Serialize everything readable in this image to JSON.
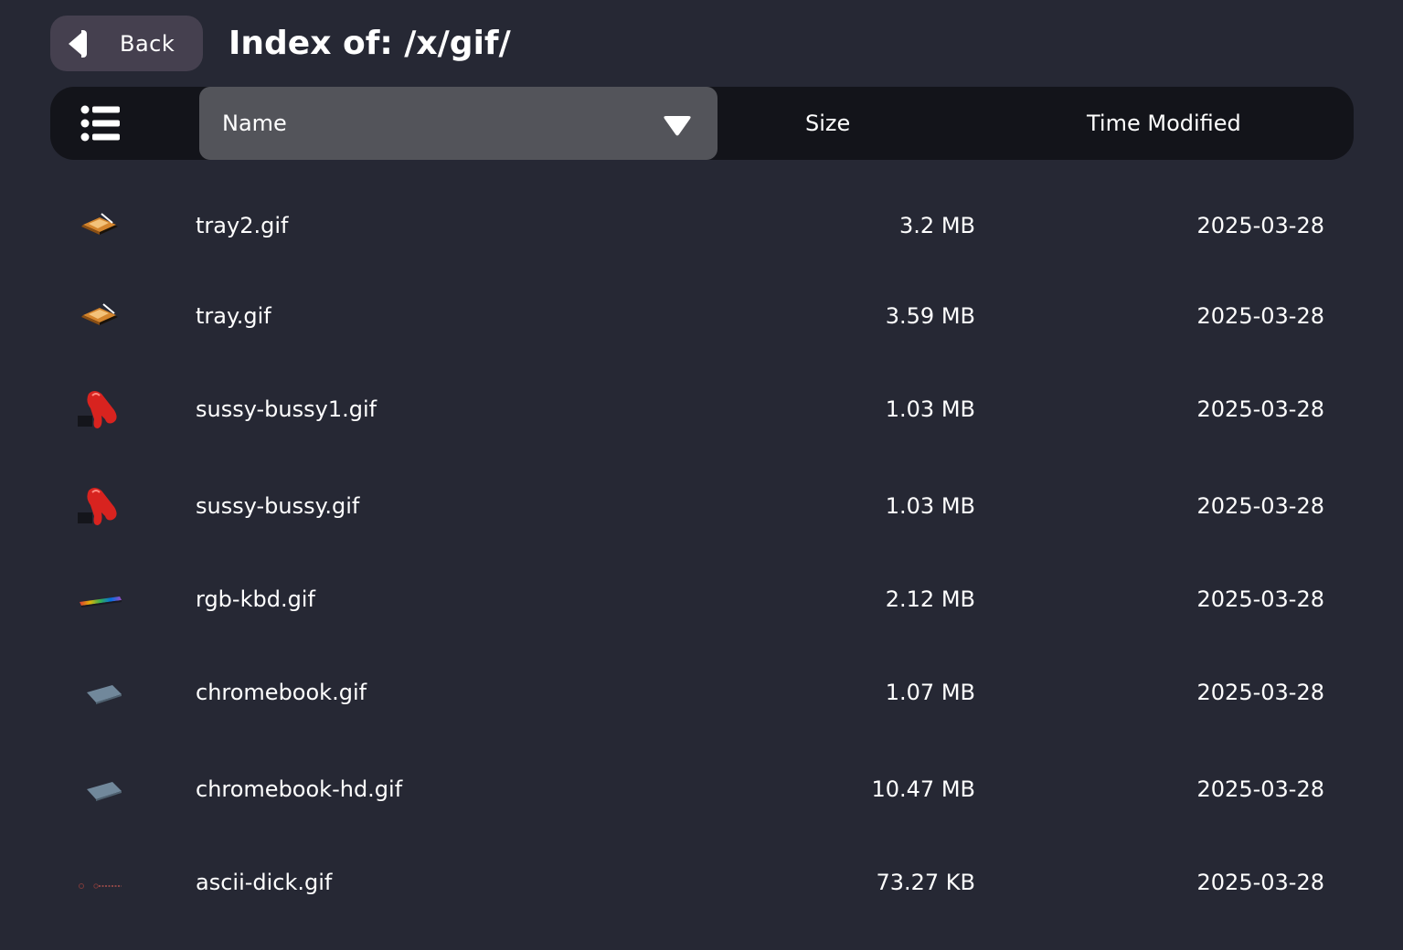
{
  "header": {
    "back_label": "Back",
    "title": "Index of: /x/gif/"
  },
  "columns": {
    "name": "Name",
    "size": "Size",
    "time": "Time Modified",
    "sort_column": "Name",
    "sort_direction": "descending"
  },
  "files": [
    {
      "name": "tray2.gif",
      "size": "3.2 MB",
      "date": "2025-03-28",
      "thumb": "tray-thumb"
    },
    {
      "name": "tray.gif",
      "size": "3.59 MB",
      "date": "2025-03-28",
      "thumb": "tray-thumb"
    },
    {
      "name": "sussy-bussy1.gif",
      "size": "1.03 MB",
      "date": "2025-03-28",
      "thumb": "red-figure-thumb"
    },
    {
      "name": "sussy-bussy.gif",
      "size": "1.03 MB",
      "date": "2025-03-28",
      "thumb": "red-figure-thumb"
    },
    {
      "name": "rgb-kbd.gif",
      "size": "2.12 MB",
      "date": "2025-03-28",
      "thumb": "rgb-keyboard-thumb"
    },
    {
      "name": "chromebook.gif",
      "size": "1.07 MB",
      "date": "2025-03-28",
      "thumb": "laptop-thumb"
    },
    {
      "name": "chromebook-hd.gif",
      "size": "10.47 MB",
      "date": "2025-03-28",
      "thumb": "laptop-thumb"
    },
    {
      "name": "ascii-dick.gif",
      "size": "73.27 KB",
      "date": "2025-03-28",
      "thumb": "ascii-thumb"
    }
  ],
  "colors": {
    "background": "#262834",
    "header_bar": "#13141a",
    "sort_active": "#53545a",
    "back_button": "#45404f",
    "text": "#ffffff"
  }
}
